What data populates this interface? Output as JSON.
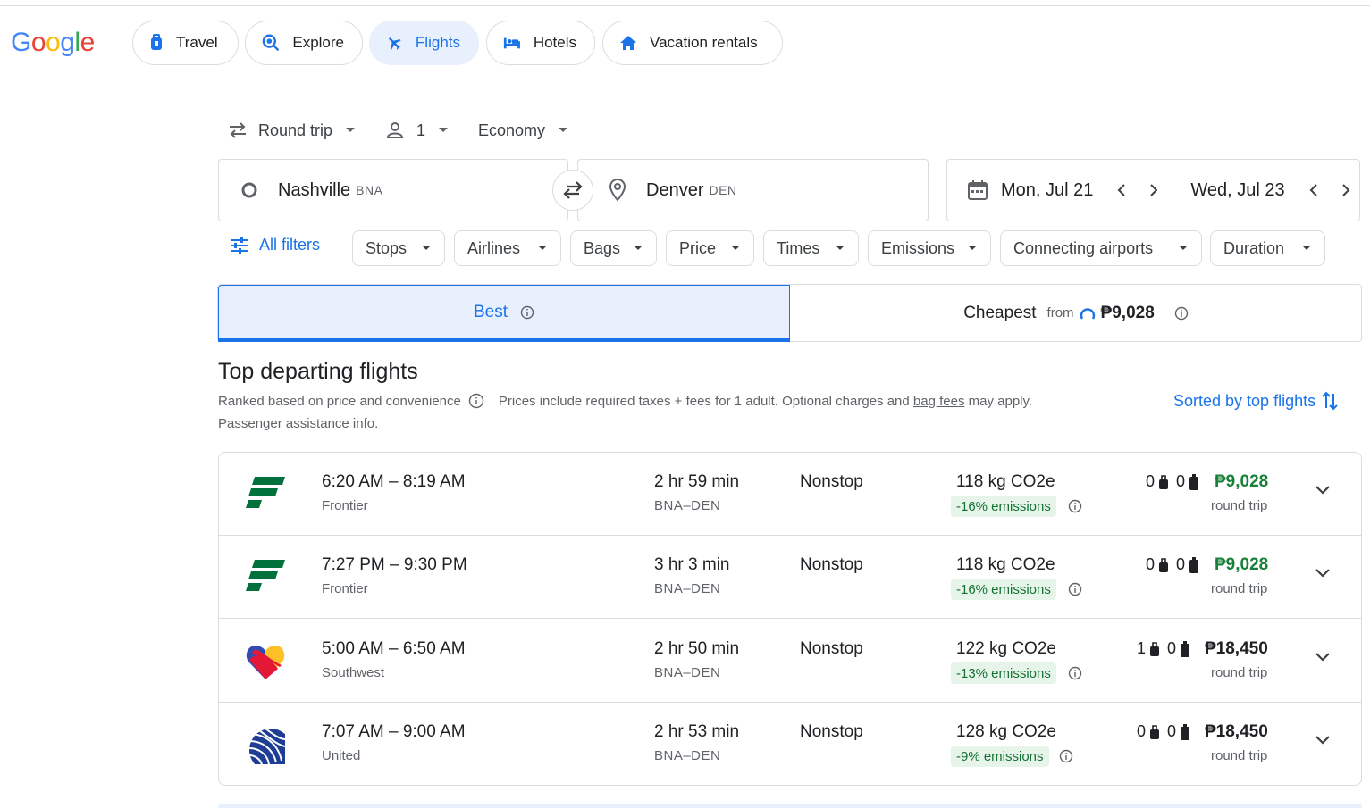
{
  "logo": "Google",
  "nav": [
    {
      "label": "Travel",
      "icon": "travel-bag-icon"
    },
    {
      "label": "Explore",
      "icon": "explore-icon"
    },
    {
      "label": "Flights",
      "icon": "plane-icon"
    },
    {
      "label": "Hotels",
      "icon": "bed-icon"
    },
    {
      "label": "Vacation rentals",
      "icon": "house-icon"
    }
  ],
  "trip": {
    "type": "Round trip",
    "passengers": "1",
    "cabin": "Economy"
  },
  "search": {
    "origin": "Nashville",
    "origin_code": "BNA",
    "destination": "Denver",
    "destination_code": "DEN",
    "depart": "Mon, Jul 21",
    "return": "Wed, Jul 23"
  },
  "filters": {
    "all": "All filters",
    "chips": [
      "Stops",
      "Airlines",
      "Bags",
      "Price",
      "Times",
      "Emissions",
      "Connecting airports",
      "Duration"
    ]
  },
  "tabs": {
    "best": "Best",
    "cheapest": "Cheapest",
    "from": "from",
    "cheapest_price": "₱9,028"
  },
  "results": {
    "title": "Top departing flights",
    "ranked": "Ranked based on price and convenience",
    "prices_note_1": "Prices include required taxes + fees for 1 adult. Optional charges and",
    "bag_fees": "bag fees",
    "prices_note_2": "may apply.",
    "passenger_assistance": "Passenger assistance",
    "info": "info.",
    "sorted": "Sorted by top flights"
  },
  "flights": [
    {
      "times": "6:20 AM – 8:19 AM",
      "airline": "Frontier",
      "duration": "2 hr 59 min",
      "route": "BNA–DEN",
      "stops": "Nonstop",
      "co2": "118 kg CO2e",
      "emissions": "-16% emissions",
      "carry_on": "0",
      "checked": "0",
      "price": "₱9,028",
      "trip": "round trip",
      "logo": "frontier"
    },
    {
      "times": "7:27 PM – 9:30 PM",
      "airline": "Frontier",
      "duration": "3 hr 3 min",
      "route": "BNA–DEN",
      "stops": "Nonstop",
      "co2": "118 kg CO2e",
      "emissions": "-16% emissions",
      "carry_on": "0",
      "checked": "0",
      "price": "₱9,028",
      "trip": "round trip",
      "logo": "frontier"
    },
    {
      "times": "5:00 AM – 6:50 AM",
      "airline": "Southwest",
      "duration": "2 hr 50 min",
      "route": "BNA–DEN",
      "stops": "Nonstop",
      "co2": "122 kg CO2e",
      "emissions": "-13% emissions",
      "carry_on": "1",
      "checked": "0",
      "price": "₱18,450",
      "trip": "round trip",
      "logo": "southwest"
    },
    {
      "times": "7:07 AM – 9:00 AM",
      "airline": "United",
      "duration": "2 hr 53 min",
      "route": "BNA–DEN",
      "stops": "Nonstop",
      "co2": "128 kg CO2e",
      "emissions": "-9% emissions",
      "carry_on": "0",
      "checked": "0",
      "price": "₱18,450",
      "trip": "round trip",
      "logo": "united"
    }
  ],
  "colors": {
    "accent": "#1a73e8",
    "accent_bg": "#e8f0fe",
    "green": "#188038",
    "emission_bg": "#e6f4ea",
    "border": "#dadce0",
    "frontier": "#00703c",
    "southwest_blue": "#304cb2",
    "southwest_red": "#e31837",
    "southwest_yellow": "#ffbf27"
  }
}
